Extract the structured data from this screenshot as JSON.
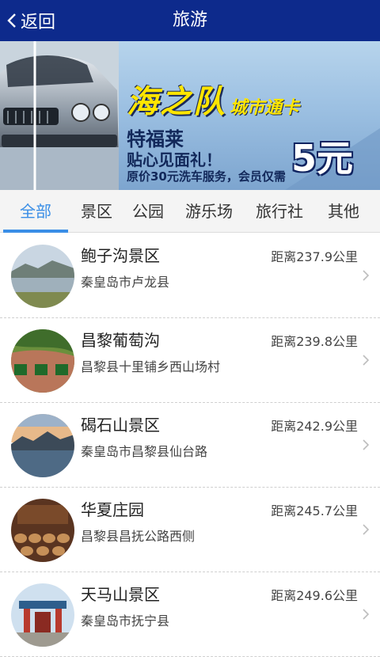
{
  "header": {
    "back_label": "返回",
    "title": "旅游"
  },
  "banner": {
    "slogan_main": "海之队",
    "slogan_sub": "城市通卡",
    "brand": "特福莱",
    "gift": "贴心见面礼！",
    "promo": "原价30元洗车服务，会员仅需",
    "price": "5元"
  },
  "tabs": [
    {
      "label": "全部",
      "active": true
    },
    {
      "label": "景区",
      "active": false
    },
    {
      "label": "公园",
      "active": false
    },
    {
      "label": "游乐场",
      "active": false
    },
    {
      "label": "旅行社",
      "active": false
    },
    {
      "label": "其他",
      "active": false
    }
  ],
  "items": [
    {
      "name": "鲍子沟景区",
      "address": "秦皇岛市卢龙县",
      "distance": "距离237.9公里"
    },
    {
      "name": "昌黎葡萄沟",
      "address": "昌黎县十里铺乡西山场村",
      "distance": "距离239.8公里"
    },
    {
      "name": "碣石山景区",
      "address": "秦皇岛市昌黎县仙台路",
      "distance": "距离242.9公里"
    },
    {
      "name": "华夏庄园",
      "address": "昌黎县昌抚公路西侧",
      "distance": "距离245.7公里"
    },
    {
      "name": "天马山景区",
      "address": "秦皇岛市抚宁县",
      "distance": "距离249.6公里"
    }
  ],
  "colors": {
    "header_bg": "#0d2a8c",
    "tab_active": "#3a8ee6",
    "slogan": "#ffe500"
  }
}
